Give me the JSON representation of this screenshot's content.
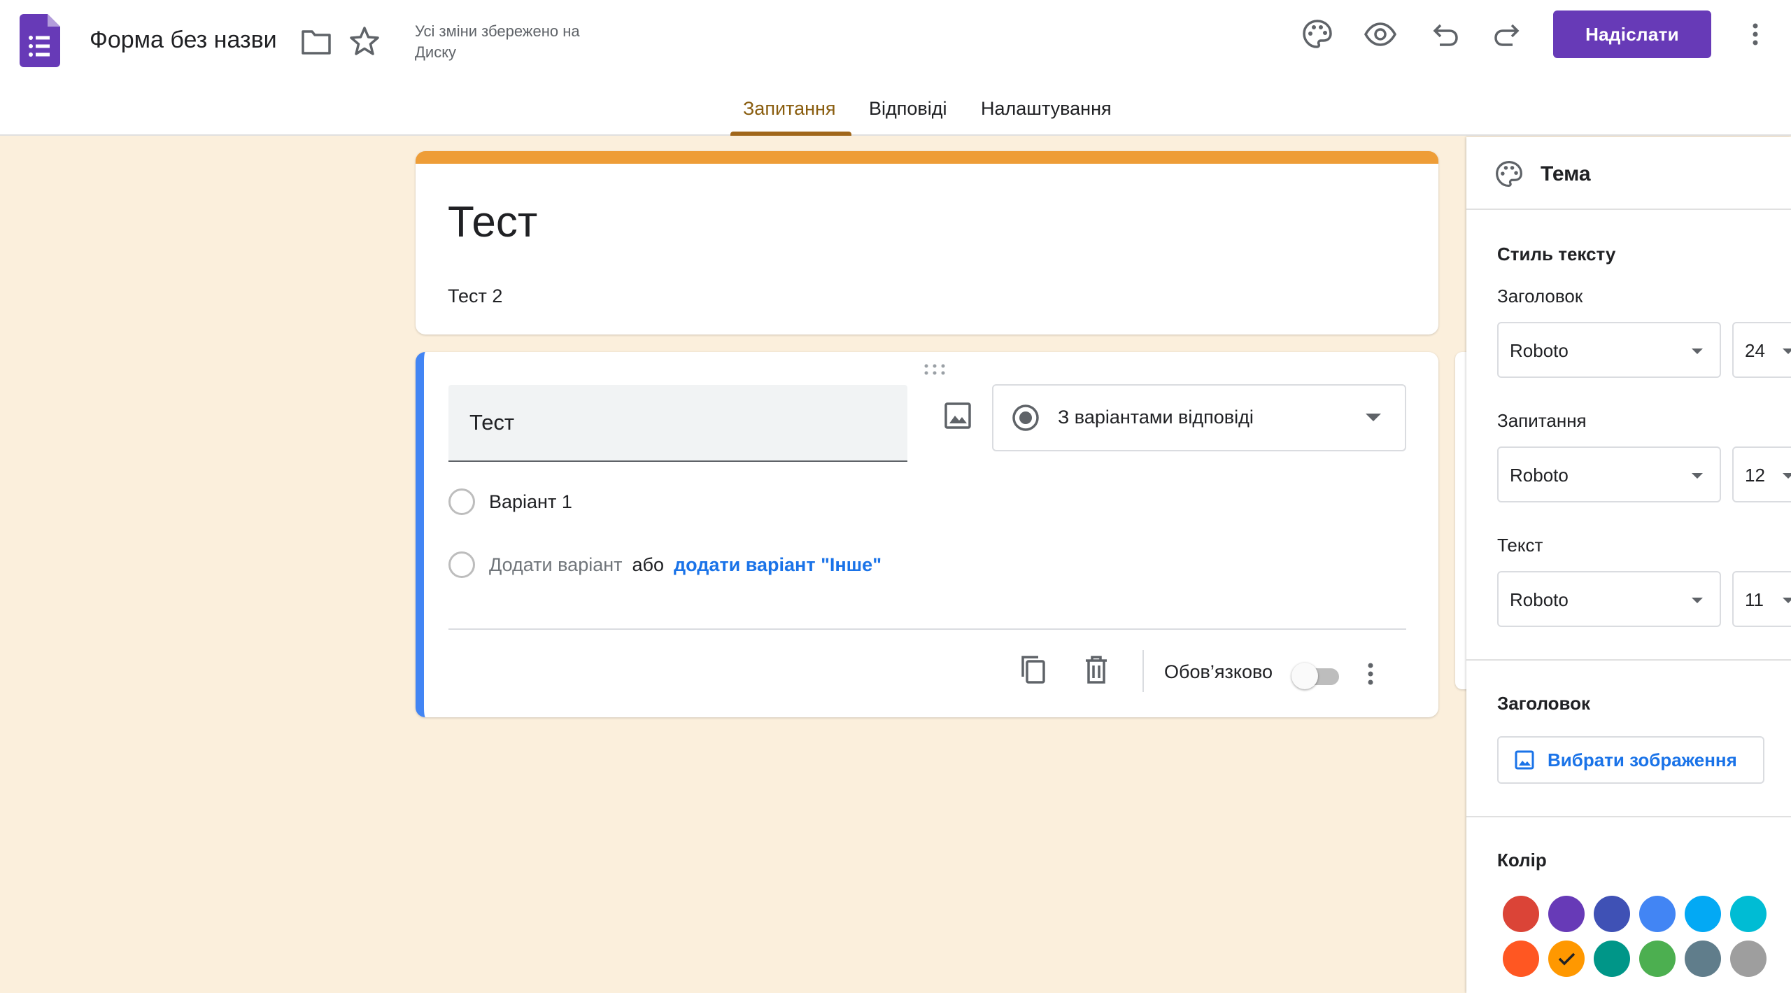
{
  "header": {
    "doc_title": "Форма без назви",
    "save_status": "Усі зміни збережено на Диску",
    "send_label": "Надіслати",
    "icons": [
      "palette-icon",
      "preview-icon",
      "undo-icon",
      "redo-icon",
      "more-vert-icon"
    ],
    "accent_color": "#673ab7"
  },
  "tabs": [
    {
      "label": "Запитання",
      "active": true
    },
    {
      "label": "Відповіді",
      "active": false
    },
    {
      "label": "Налаштування",
      "active": false
    }
  ],
  "form": {
    "title": "Тест",
    "description": "Тест 2",
    "header_color": "#ee9d37",
    "background_color": "#fbefdc"
  },
  "question": {
    "text": "Тест",
    "type_label": "З варіантами відповіді",
    "options": [
      "Варіант 1"
    ],
    "add_option_label": "Додати варіант",
    "or_label": "або",
    "add_other_label": "додати варіант \"Інше\"",
    "required_label": "Обов’язково",
    "required": false
  },
  "theme_panel": {
    "title": "Тема",
    "text_style_heading": "Стиль тексту",
    "header_label": "Заголовок",
    "header_font": "Roboto",
    "header_size": "24",
    "question_label": "Запитання",
    "question_font": "Roboto",
    "question_size": "12",
    "text_label": "Текст",
    "text_font": "Roboto",
    "text_size": "11",
    "header_section_heading": "Заголовок",
    "choose_image_label": "Вибрати зображення",
    "color_heading": "Колір",
    "colors": [
      "#db4437",
      "#673ab7",
      "#3f51b5",
      "#4285f4",
      "#03a9f4",
      "#00bcd4",
      "#ff5722",
      "#ff9800",
      "#009688",
      "#4caf50",
      "#607d8b",
      "#9e9e9e"
    ],
    "selected_color": "#ff9800"
  }
}
